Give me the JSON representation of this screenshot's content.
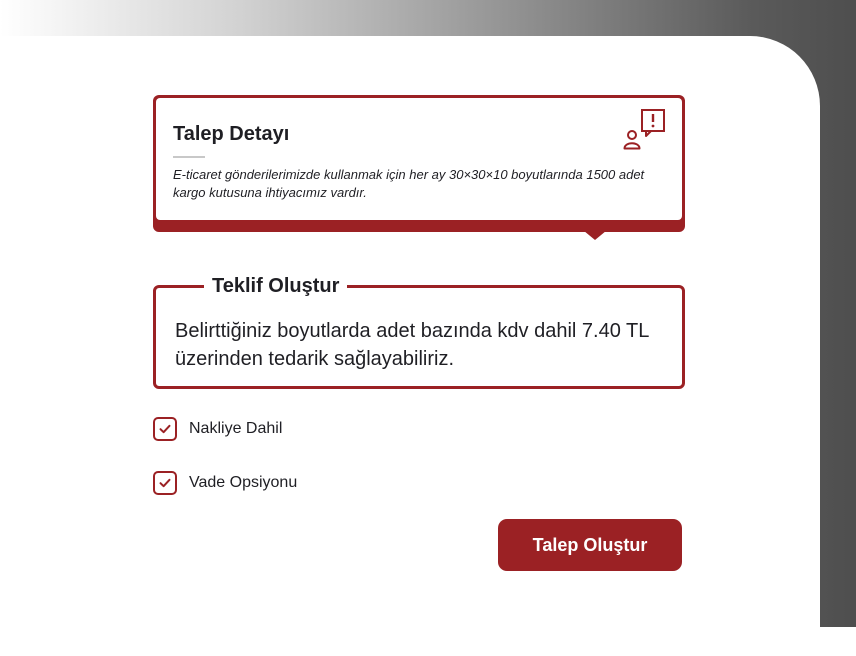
{
  "request_card": {
    "title": "Talep Detayı",
    "description": "E-ticaret gönderilerimizde kullanmak için her ay 30×30×10 boyutlarında 1500 adet kargo kutusuna ihtiyacımız vardır.",
    "icon": "user-alert-icon"
  },
  "offer": {
    "legend": "Teklif Oluştur",
    "text": "Belirttiğiniz boyutlarda adet bazında kdv dahil 7.40 TL üzerinden tedarik sağlayabiliriz."
  },
  "options": [
    {
      "label": "Nakliye Dahil",
      "checked": true
    },
    {
      "label": "Vade Opsiyonu",
      "checked": true
    }
  ],
  "submit_label": "Talep Oluştur",
  "colors": {
    "accent": "#9b2124",
    "text": "#1f1f24",
    "frame_dark": "#4e4e4e"
  }
}
